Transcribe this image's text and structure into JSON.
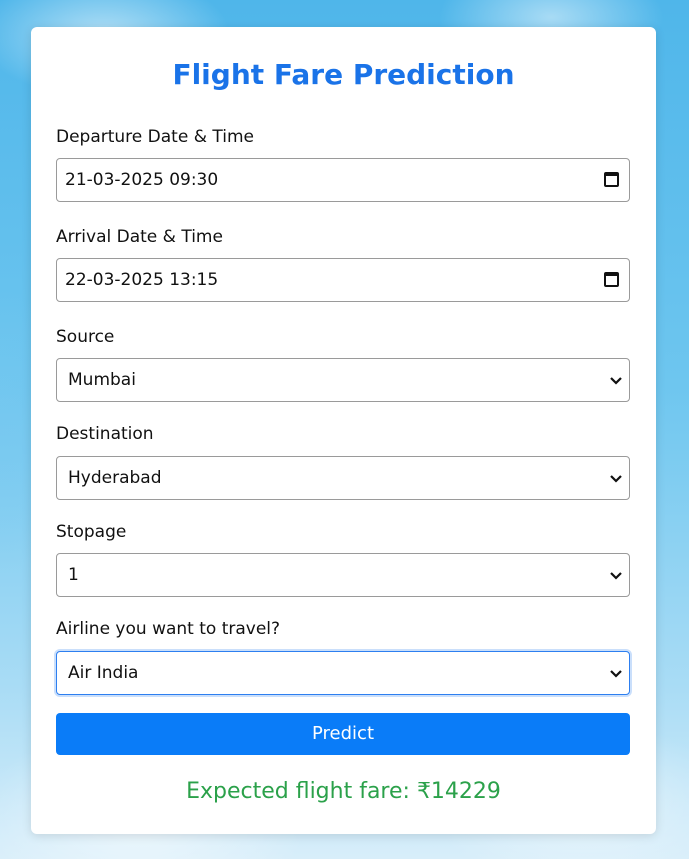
{
  "form": {
    "title": "Flight Fare Prediction",
    "departure": {
      "label": "Departure Date & Time",
      "value": "21-03-2025 09:30"
    },
    "arrival": {
      "label": "Arrival Date & Time",
      "value": "22-03-2025 13:15"
    },
    "source": {
      "label": "Source",
      "value": "Mumbai"
    },
    "destination": {
      "label": "Destination",
      "value": "Hyderabad"
    },
    "stopage": {
      "label": "Stopage",
      "value": "1"
    },
    "airline": {
      "label": "Airline you want to travel?",
      "value": "Air India"
    },
    "predict_label": "Predict",
    "result_text": "Expected flight fare: ₹14229"
  },
  "colors": {
    "title": "#1a73e8",
    "button": "#0a7cf8",
    "result": "#2ba14a"
  }
}
